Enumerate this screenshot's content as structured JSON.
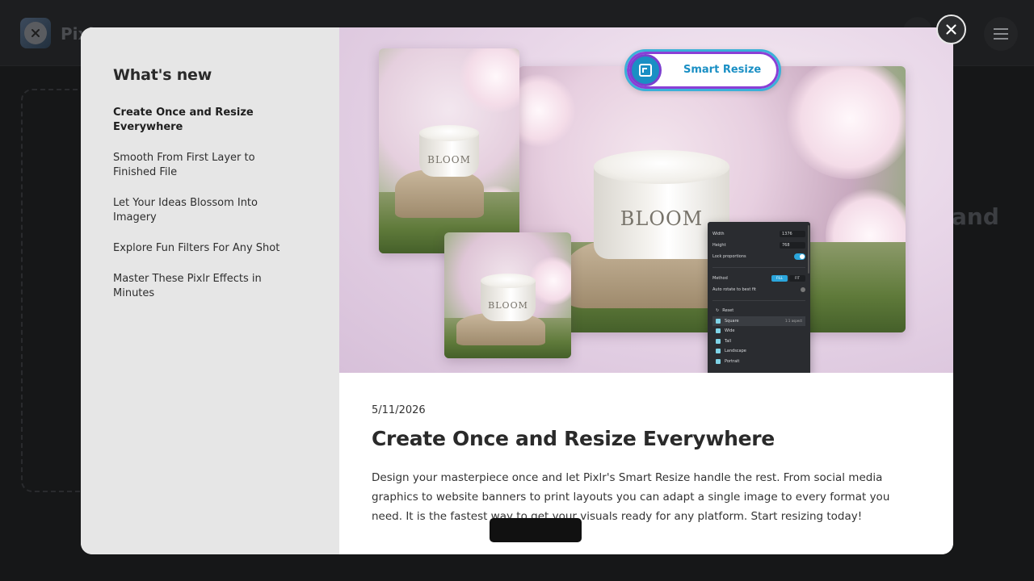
{
  "background": {
    "logo_text": "Pixl",
    "partial_text": "and"
  },
  "modal": {
    "sidebar": {
      "title": "What's new",
      "items": [
        {
          "label": "Create Once and Resize Everywhere",
          "active": true
        },
        {
          "label": "Smooth From First Layer to Finished File",
          "active": false
        },
        {
          "label": "Let Your Ideas Blossom Into Imagery",
          "active": false
        },
        {
          "label": "Explore Fun Filters For Any Shot",
          "active": false
        },
        {
          "label": "Master These Pixlr Effects in Minutes",
          "active": false
        }
      ]
    },
    "hero": {
      "badge_label": "Smart Resize",
      "jar_label": "BLOOM",
      "panel": {
        "width_label": "Width",
        "width_value": "1376",
        "height_label": "Height",
        "height_value": "768",
        "lock_label": "Lock proportions",
        "method_label": "Method",
        "method_fill": "FILL",
        "method_fit": "FIT",
        "auto_rotate_label": "Auto rotate to best fit",
        "reset_label": "Reset",
        "presets": [
          {
            "label": "Square",
            "meta": "1:1 aspect",
            "selected": true
          },
          {
            "label": "Wide",
            "meta": "",
            "selected": false
          },
          {
            "label": "Tall",
            "meta": "",
            "selected": false
          },
          {
            "label": "Landscape",
            "meta": "",
            "selected": false
          },
          {
            "label": "Portrait",
            "meta": "",
            "selected": false
          }
        ]
      }
    },
    "article": {
      "date": "5/11/2026",
      "title": "Create Once and Resize Everywhere",
      "body": "Design your masterpiece once and let Pixlr's Smart Resize handle the rest. From social media graphics to website banners to print layouts you can adapt a single image to every format you need. It is the fastest way to get your visuals ready for any platform. Start resizing today!"
    }
  },
  "colors": {
    "accent": "#1a8fc4",
    "badge_border": "#7b3fcf",
    "sidebar_bg": "#e6e6e6",
    "overlay_bg": "#161718"
  }
}
